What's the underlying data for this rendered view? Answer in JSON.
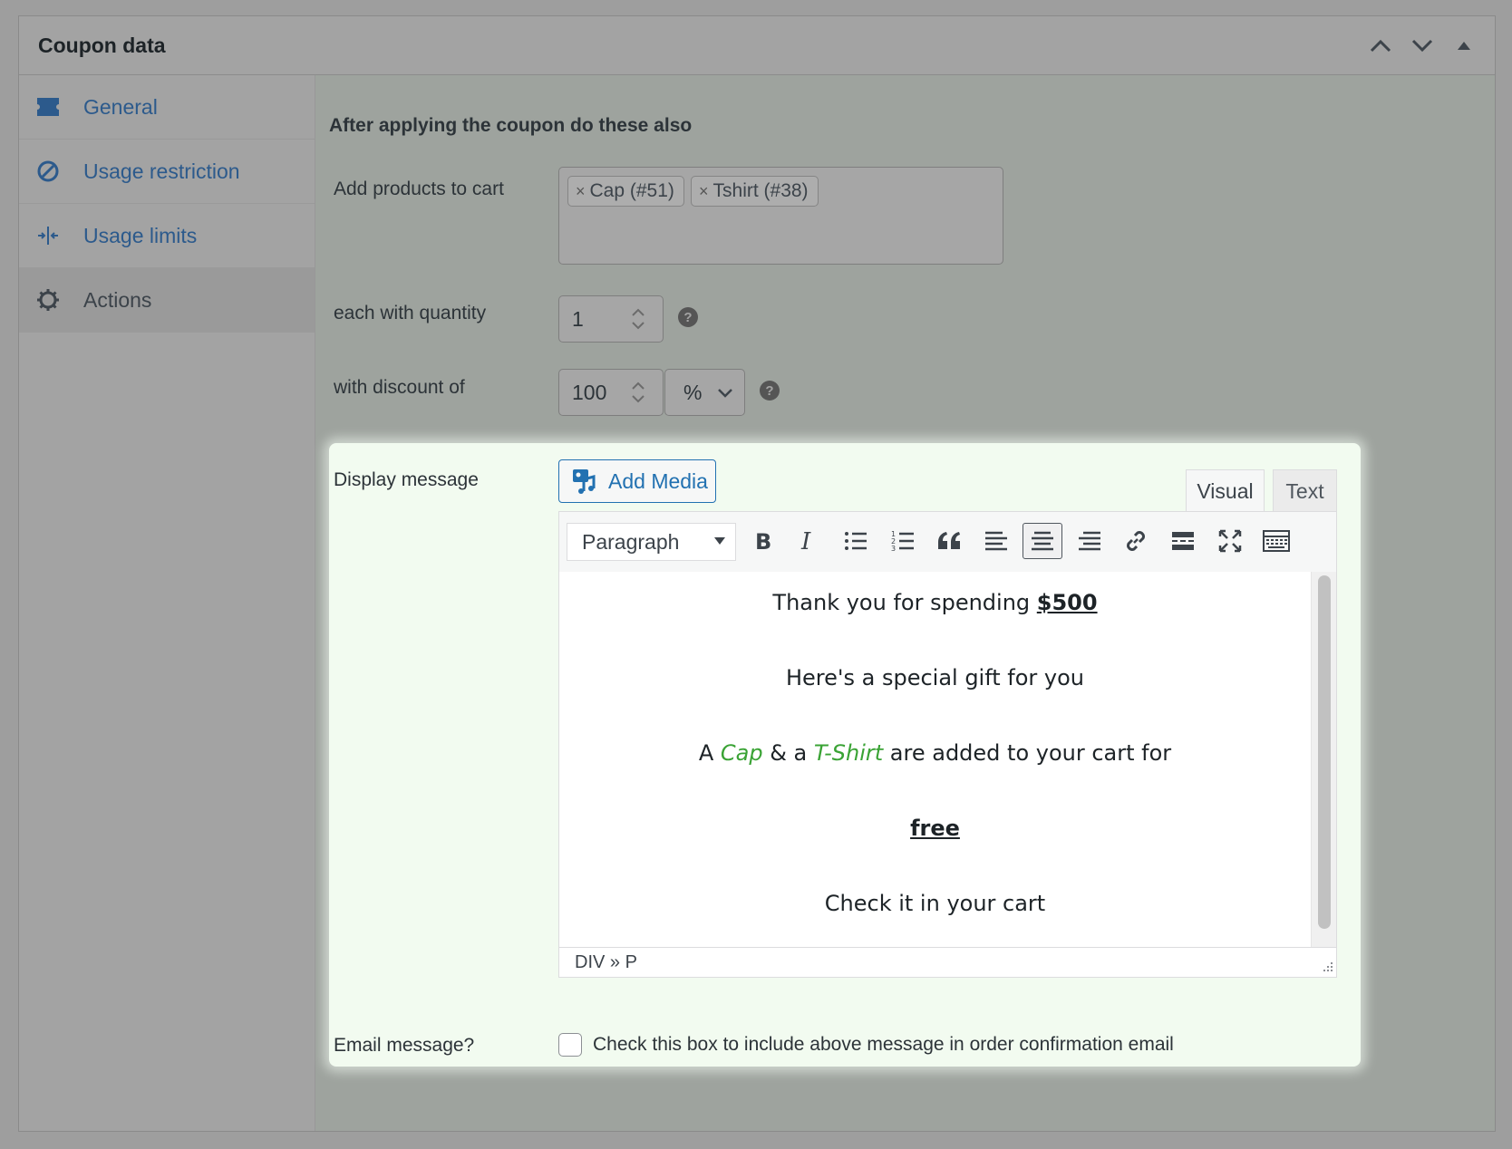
{
  "panel": {
    "title": "Coupon data",
    "header_buttons": [
      "chevron-up-icon",
      "chevron-down-icon",
      "triangle-up-icon"
    ]
  },
  "sidebar": {
    "items": [
      {
        "label": "General",
        "icon": "ticket-icon",
        "active": false
      },
      {
        "label": "Usage restriction",
        "icon": "ban-icon",
        "active": false
      },
      {
        "label": "Usage limits",
        "icon": "arrows-in-icon",
        "active": false
      },
      {
        "label": "Actions",
        "icon": "gear-icon",
        "active": true
      }
    ]
  },
  "actions": {
    "heading": "After applying the coupon do these also",
    "add_products_label": "Add products to cart",
    "products": [
      {
        "label": "Cap (#51)"
      },
      {
        "label": "Tshirt (#38)"
      }
    ],
    "quantity_label": "each with quantity",
    "quantity_value": "1",
    "discount_label": "with discount of",
    "discount_value": "100",
    "discount_type": "%",
    "help_glyph": "?"
  },
  "display_message": {
    "label": "Display message",
    "add_media": "Add Media",
    "tab_visual": "Visual",
    "tab_text": "Text",
    "format": "Paragraph",
    "lines": {
      "l1_pre": "Thank you for spending ",
      "l1_amount": "$500",
      "l2": "Here's a special gift for you",
      "l3_a": "A ",
      "l3_cap": "Cap",
      "l3_mid": " & a ",
      "l3_tshirt": "T-Shirt",
      "l3_post": " are added to your cart for",
      "l4": "free",
      "l5": "Check it in your cart"
    },
    "path": "DIV » P",
    "accent_color": "#3aa335"
  },
  "email": {
    "label": "Email message?",
    "checkbox_label": "Check this box to include above message in order confirmation email",
    "checked": false
  }
}
